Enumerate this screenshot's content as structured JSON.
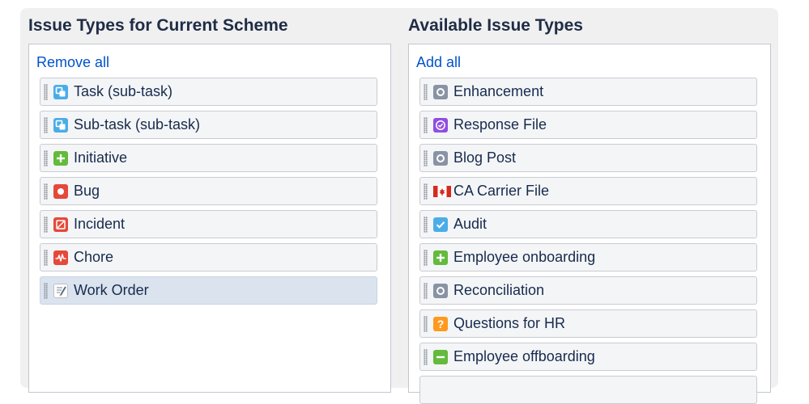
{
  "left_column": {
    "title": "Issue Types for Current Scheme",
    "action": "Remove all",
    "items": [
      {
        "label": "Task (sub-task)",
        "icon": "subtask-icon"
      },
      {
        "label": "Sub-task (sub-task)",
        "icon": "subtask-icon"
      },
      {
        "label": "Initiative",
        "icon": "plus-icon"
      },
      {
        "label": "Bug",
        "icon": "bug-icon"
      },
      {
        "label": "Incident",
        "icon": "incident-icon"
      },
      {
        "label": "Chore",
        "icon": "pulse-icon"
      },
      {
        "label": "Work Order",
        "icon": "notepad-icon"
      }
    ]
  },
  "right_column": {
    "title": "Available Issue Types",
    "action": "Add all",
    "items": [
      {
        "label": "Enhancement",
        "icon": "generic-icon"
      },
      {
        "label": "Response File",
        "icon": "check-circle-icon"
      },
      {
        "label": "Blog Post",
        "icon": "generic-icon"
      },
      {
        "label": "CA Carrier File",
        "icon": "canada-flag-icon"
      },
      {
        "label": "Audit",
        "icon": "checkbox-icon"
      },
      {
        "label": "Employee onboarding",
        "icon": "plus-icon"
      },
      {
        "label": "Reconciliation",
        "icon": "generic-icon"
      },
      {
        "label": "Questions for HR",
        "icon": "question-icon"
      },
      {
        "label": "Employee offboarding",
        "icon": "minus-icon"
      }
    ]
  },
  "colors": {
    "link": "#0052cc",
    "subtask": "#4bade8",
    "green": "#63ba3c",
    "red": "#e5493a",
    "purple": "#904ee2",
    "gray": "#8993a4",
    "orange": "#ff991f",
    "selected_row": "#dae3ee"
  }
}
